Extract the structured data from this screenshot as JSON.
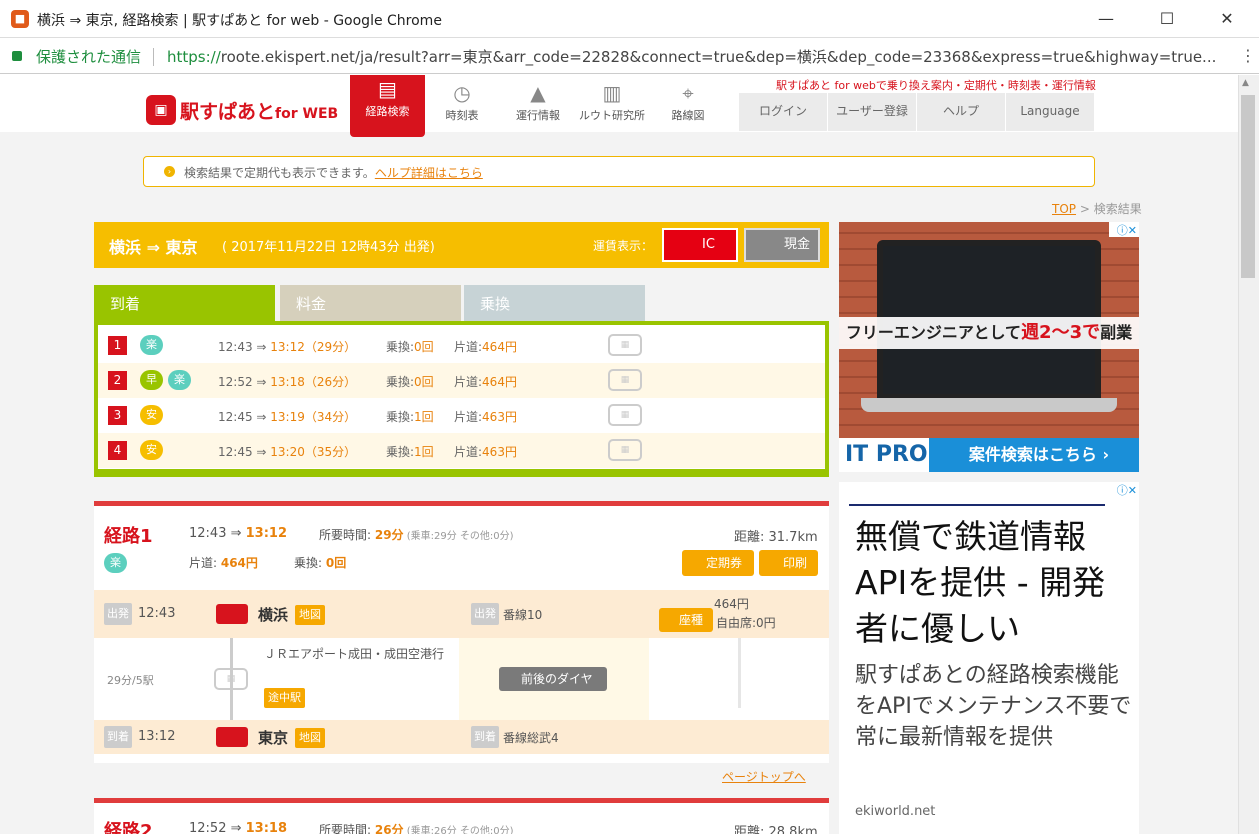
{
  "window": {
    "title": "横浜 ⇒ 東京, 経路検索 | 駅すぱあと for web - Google Chrome",
    "min": "—",
    "max": "☐",
    "close": "✕"
  },
  "address": {
    "secure": "保護された通信",
    "https": "https://",
    "url": "roote.ekispert.net/ja/result?arr=東京&arr_code=22828&connect=true&dep=横浜&dep_code=23368&express=true&highway=true..."
  },
  "header": {
    "logo": "駅すぱあと",
    "logo_suffix": "for WEB",
    "tagline": "駅すぱあと for webで乗り換え案内・定期代・時刻表・運行情報",
    "nav": [
      "経路検索",
      "時刻表",
      "運行情報",
      "ルウト研究所",
      "路線図"
    ],
    "user_nav": [
      "ログイン",
      "ユーザー登録",
      "ヘルプ",
      "Language"
    ]
  },
  "notice": {
    "text": "検索結果で定期代も表示できます。",
    "link": "ヘルプ詳細はこちら"
  },
  "breadcrumb": {
    "top": "TOP",
    "sep": " > ",
    "current": "検索結果"
  },
  "summary": {
    "title": "横浜 ⇒ 東京",
    "date": "( 2017年11月22日 12時43分 出発)",
    "fare_label": "運賃表示：",
    "ic": "IC",
    "cash": "現金"
  },
  "tabs": [
    "到着",
    "料金",
    "乗換"
  ],
  "routes": [
    {
      "num": "1",
      "chips": [
        "楽"
      ],
      "dep": "12:43 ⇒ ",
      "arr": "13:12（29分）",
      "xfer_label": "乗換:",
      "xfer": "0回",
      "fare_label": "片道:",
      "fare": "464円"
    },
    {
      "num": "2",
      "chips": [
        "早",
        "楽"
      ],
      "dep": "12:52 ⇒ ",
      "arr": "13:18（26分）",
      "xfer_label": "乗換:",
      "xfer": "0回",
      "fare_label": "片道:",
      "fare": "464円"
    },
    {
      "num": "3",
      "chips": [
        "安"
      ],
      "dep": "12:45 ⇒ ",
      "arr": "13:19（34分）",
      "xfer_label": "乗換:",
      "xfer": "1回",
      "fare_label": "片道:",
      "fare": "463円"
    },
    {
      "num": "4",
      "chips": [
        "安"
      ],
      "dep": "12:45 ⇒ ",
      "arr": "13:20（35分）",
      "xfer_label": "乗換:",
      "xfer": "1回",
      "fare_label": "片道:",
      "fare": "463円"
    }
  ],
  "detail": {
    "name": "経路1",
    "chip": "楽",
    "dep_time": "12:43 ⇒ ",
    "arr_time": "13:12",
    "req_label": "所要時間: ",
    "req": "29分",
    "req_note": " (乗車:29分 その他:0分)",
    "dist": "距離: 31.7km",
    "fare_label": "片道: ",
    "fare": "464円",
    "xfer_label": "乗換: ",
    "xfer": "0回",
    "commuter_btn": "定期券",
    "print_btn": "印刷",
    "dep_tag": "出発",
    "dep_clock": "12:43",
    "dep_station": "横浜",
    "map": "地図",
    "dep_plat_tag": "出発",
    "dep_plat": "番線10",
    "fare_464": "464円",
    "seat_btn": "座種",
    "seat_free": "自由席:0円",
    "mid_dur": "29分/5駅",
    "line_name": "ＪＲエアポート成田・成田空港行",
    "midway_btn": "途中駅",
    "dia_btn": "前後のダイヤ",
    "arr_tag": "到着",
    "arr_clock": "13:12",
    "arr_station": "東京",
    "arr_plat_tag": "到着",
    "arr_plat": "番線総武4"
  },
  "pagetop": "ページトップへ",
  "detail2": {
    "name": "経路2",
    "dep_time": "12:52 ⇒ ",
    "arr_time": "13:18",
    "req_label": "所要時間: ",
    "req": "26分",
    "req_note": " (乗車:26分 その他:0分)",
    "dist": "距離: 28.8km"
  },
  "ad1": {
    "banner_a": "フリーエンジニアとして",
    "banner_b": "週2〜3で",
    "banner_c": "副業",
    "logo": "IT PRO",
    "cta": "案件検索はこちら ›"
  },
  "ad2": {
    "head": "無償で鉄道情報APIを提供 - 開発者に優しい",
    "body": "駅すぱあとの経路検索機能をAPIでメンテナンス不要で常に最新情報を提供",
    "domain": "ekiworld.net"
  },
  "colors": {
    "brand": "#d7131d",
    "accent": "#f6be00",
    "tab_green": "#99c400"
  }
}
